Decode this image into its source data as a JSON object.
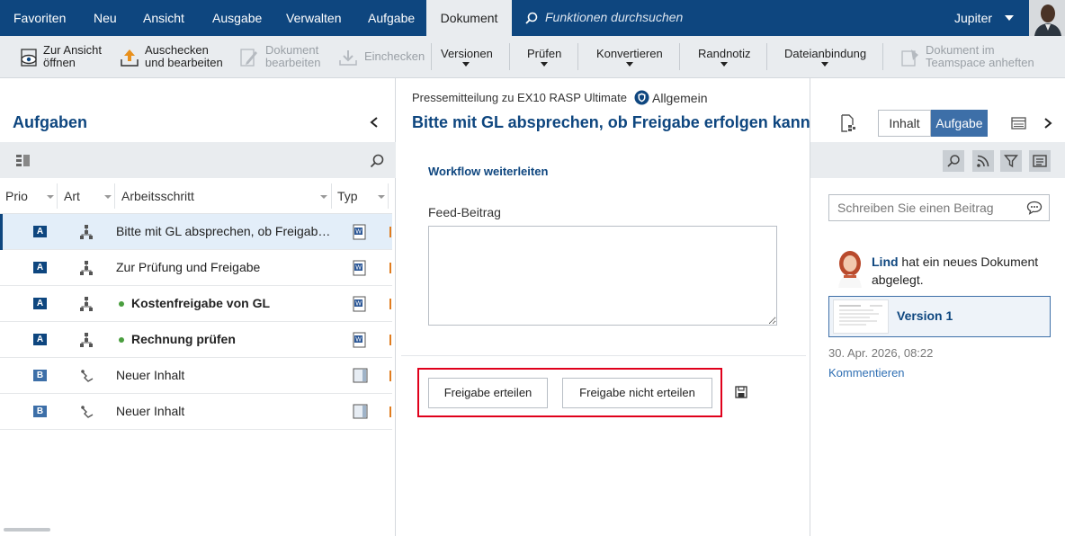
{
  "menu": {
    "items": [
      "Favoriten",
      "Neu",
      "Ansicht",
      "Ausgabe",
      "Verwalten",
      "Aufgabe",
      "Dokument"
    ],
    "active": "Dokument",
    "search_placeholder": "Funktionen durchsuchen",
    "user": "Jupiter"
  },
  "ribbon": {
    "zur_ansicht": "Zur Ansicht\nöffnen",
    "auschecken": "Auschecken\nund bearbeiten",
    "dokument_bearbeiten": "Dokument\nbearbeiten",
    "einchecken": "Einchecken",
    "versionen": "Versionen",
    "pruefen": "Prüfen",
    "konvertieren": "Konvertieren",
    "randnotiz": "Randnotiz",
    "dateianbindung": "Dateianbindung",
    "teamspace": "Dokument im\nTeamspace anheften"
  },
  "left": {
    "title": "Aufgaben",
    "columns": [
      "Prio",
      "Art",
      "Arbeitsschritt",
      "Typ"
    ],
    "rows": [
      {
        "prio": "A",
        "name": "Bitte mit GL absprechen, ob Freigabe erfolgen kann",
        "bold": false
      },
      {
        "prio": "A",
        "name": "Zur Prüfung und Freigabe",
        "bold": false
      },
      {
        "prio": "A",
        "name": "Kostenfreigabe von GL",
        "bold": true
      },
      {
        "prio": "A",
        "name": "Rechnung prüfen",
        "bold": true
      },
      {
        "prio": "B",
        "name": "Neuer Inhalt",
        "bold": false
      },
      {
        "prio": "B",
        "name": "Neuer Inhalt",
        "bold": false
      }
    ]
  },
  "center": {
    "breadcrumb": "Pressemitteilung zu EX10 RASP Ultimate",
    "category": "Allgemein",
    "title": "Bitte mit GL absprechen, ob Freigabe erfolgen kann",
    "tabs": [
      "Inhalt",
      "Aufgabe"
    ],
    "active_tab": "Aufgabe",
    "workflow_title": "Workflow weiterleiten",
    "feed_label": "Feed-Beitrag",
    "btn_grant": "Freigabe erteilen",
    "btn_deny": "Freigabe nicht erteilen"
  },
  "right": {
    "input_placeholder": "Schreiben Sie einen Beitrag",
    "entry_user": "Lind",
    "entry_text": " hat ein neues Dokument abgelegt.",
    "version_label": "Version 1",
    "date": "30. Apr. 2026, 08:22",
    "comment": "Kommentieren"
  },
  "colors": {
    "brand": "#0e467f",
    "accent": "#3d6fa8",
    "highlight": "#e0001b",
    "status_dot": "#4a9e3f"
  }
}
